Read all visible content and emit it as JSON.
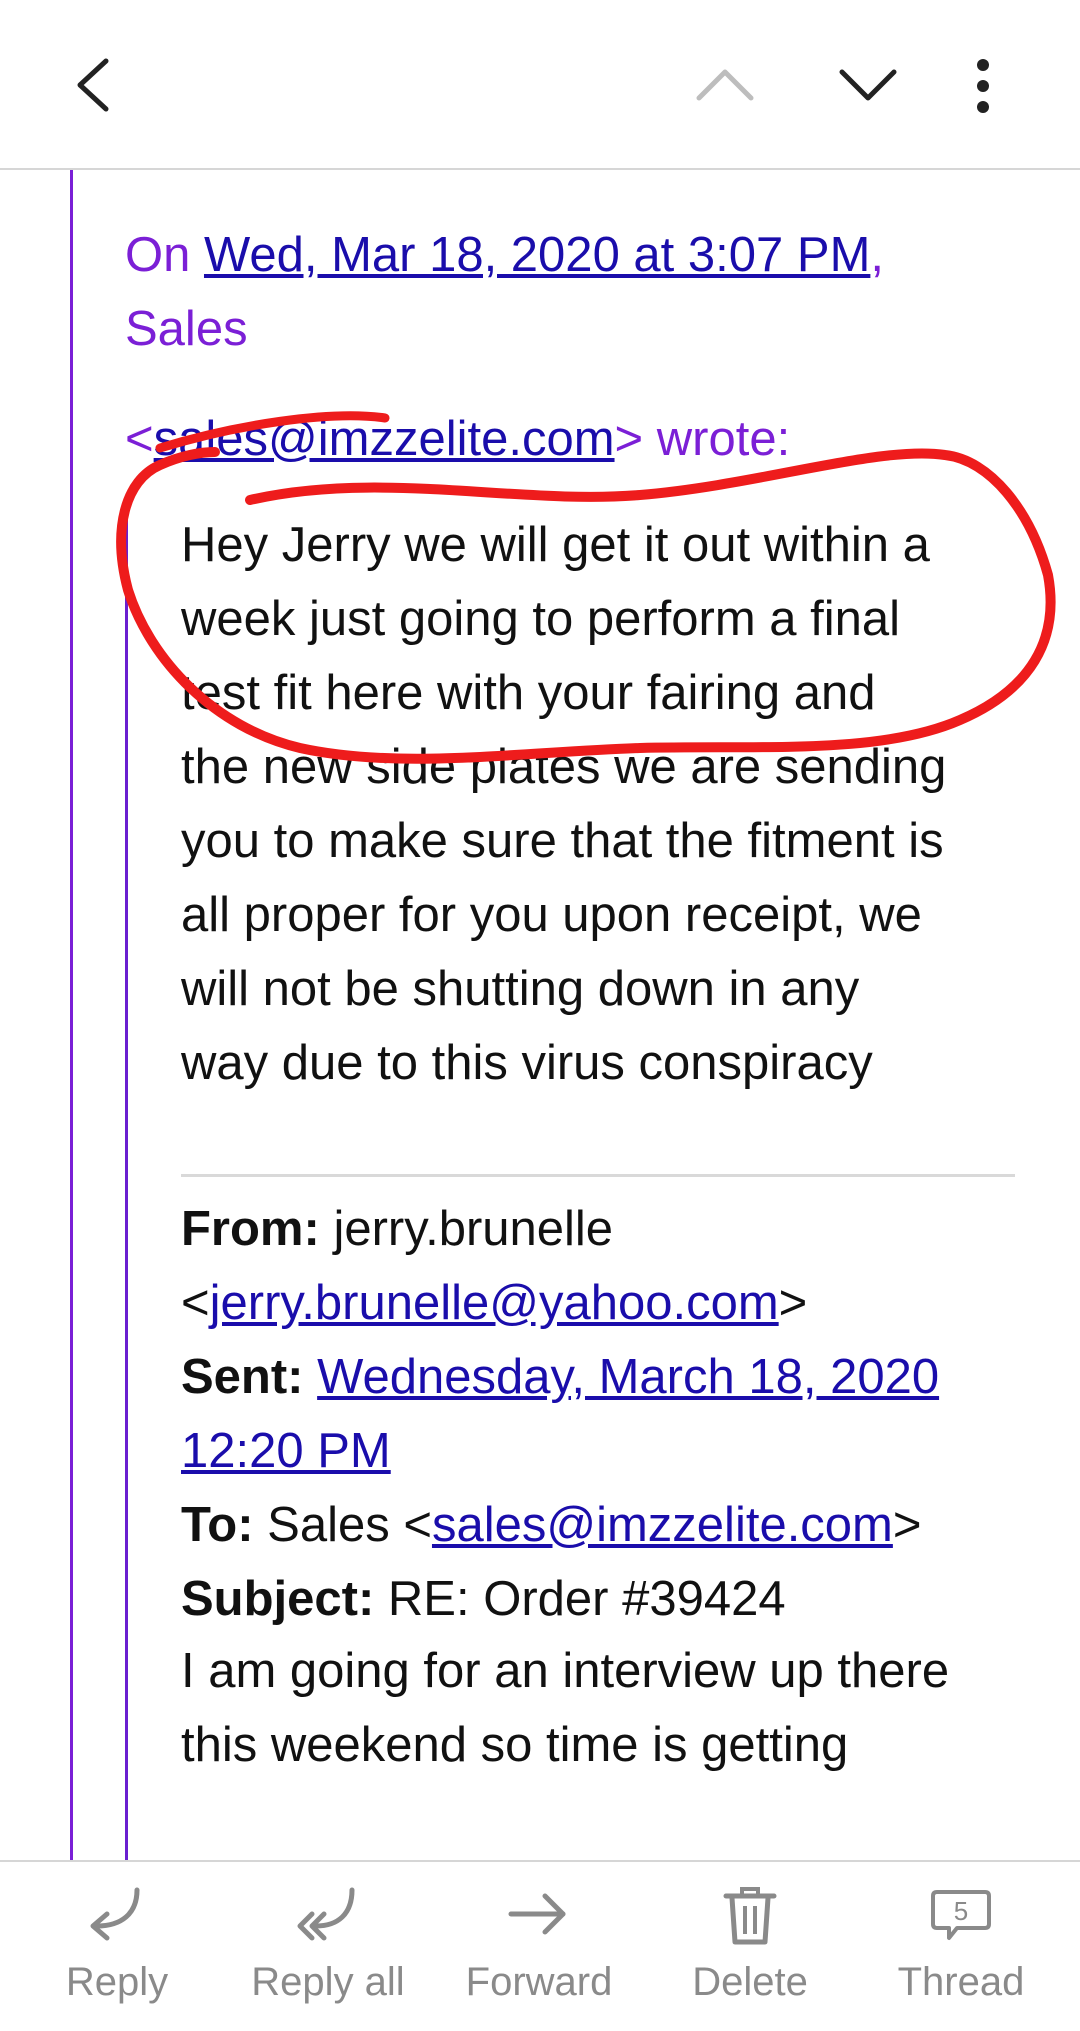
{
  "toolbar": {
    "icons": [
      "back-arrow-icon",
      "chevron-up-icon",
      "chevron-down-icon",
      "more-vertical-icon"
    ]
  },
  "quote": {
    "attribution_prefix": "On ",
    "date_link": "Wed, Mar 18, 2020 at 3:07 PM",
    "attribution_comma": ",",
    "sender_name": "Sales",
    "lt": "<",
    "sender_email": "sales@imzzelite.com",
    "wrote": "> wrote:"
  },
  "message": {
    "lines": [
      "Hey Jerry we will get it out within a",
      "week just going to perform a final",
      "test fit here with your fairing and",
      "the new side plates we are sending",
      "you to make sure that the fitment is",
      "all proper for you upon receipt, we",
      "will not be shutting down in any",
      "way due to this virus conspiracy"
    ]
  },
  "forwarded": {
    "from_label": "From:",
    "from_name": " jerry.brunelle",
    "from_lt": "<",
    "from_email": "jerry.brunelle@yahoo.com",
    "from_gt": ">",
    "sent_label": "Sent:",
    "sent_value_line1": "Wednesday, March 18, 2020",
    "sent_value_line2": "12:20 PM",
    "to_label": "To:",
    "to_name": " Sales <",
    "to_email": "sales@imzzelite.com",
    "to_gt": ">",
    "subject_label": "Subject:",
    "subject_value": " RE: Order #39424",
    "body_lines": [
      "I am going for an interview up there",
      "this weekend so time is getting"
    ]
  },
  "actions": [
    {
      "label": "Reply",
      "icon": "reply-icon"
    },
    {
      "label": "Reply all",
      "icon": "reply-all-icon"
    },
    {
      "label": "Forward",
      "icon": "forward-icon"
    },
    {
      "label": "Delete",
      "icon": "trash-icon"
    },
    {
      "label": "Thread",
      "icon": "thread-icon",
      "badge": "5"
    }
  ],
  "colors": {
    "quote_purple": "#7b1fd6",
    "link_blue": "#1a0dab",
    "annotation_red": "#ee1c1c",
    "action_gray": "#8a8a8a"
  }
}
